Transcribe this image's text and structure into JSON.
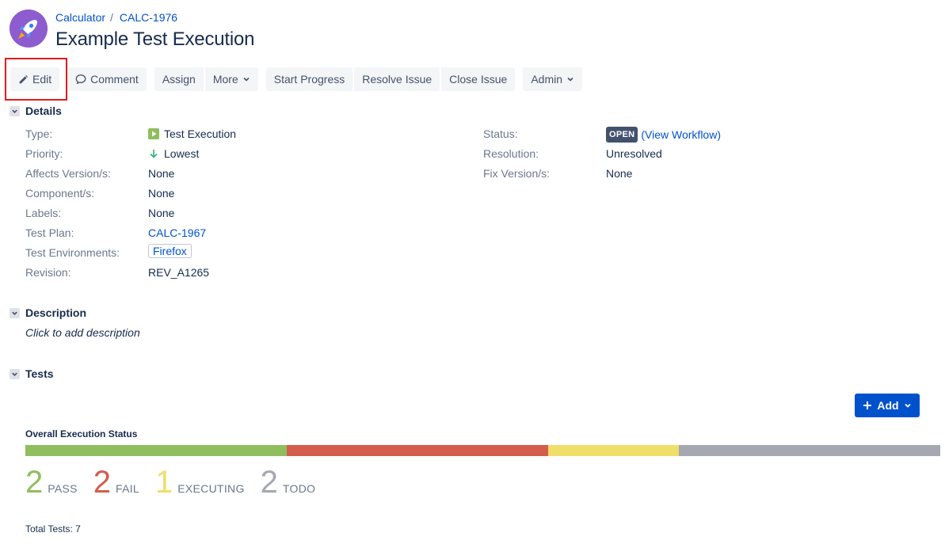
{
  "header": {
    "project": "Calculator",
    "issue_key": "CALC-1976",
    "title": "Example Test Execution"
  },
  "toolbar": {
    "edit": "Edit",
    "comment": "Comment",
    "assign": "Assign",
    "more": "More",
    "start_progress": "Start Progress",
    "resolve_issue": "Resolve Issue",
    "close_issue": "Close Issue",
    "admin": "Admin"
  },
  "details": {
    "heading": "Details",
    "left": [
      {
        "label": "Type:",
        "value": "Test Execution",
        "icon": "test-execution-icon"
      },
      {
        "label": "Priority:",
        "value": "Lowest",
        "icon": "arrow-down-icon"
      },
      {
        "label": "Affects Version/s:",
        "value": "None"
      },
      {
        "label": "Component/s:",
        "value": "None"
      },
      {
        "label": "Labels:",
        "value": "None"
      },
      {
        "label": "Test Plan:",
        "value": "CALC-1967"
      },
      {
        "label": "Test Environments:",
        "value": "Firefox"
      },
      {
        "label": "Revision:",
        "value": "REV_A1265"
      }
    ],
    "right": [
      {
        "label": "Status:",
        "value": "OPEN",
        "extra": "(View Workflow)"
      },
      {
        "label": "Resolution:",
        "value": "Unresolved"
      },
      {
        "label": "Fix Version/s:",
        "value": "None"
      }
    ]
  },
  "description": {
    "heading": "Description",
    "placeholder": "Click to add description"
  },
  "tests": {
    "heading": "Tests",
    "add_label": "Add",
    "overall_label": "Overall Execution Status",
    "status_counts": [
      {
        "label": "PASS",
        "count": "2",
        "color": "#8fbe5e"
      },
      {
        "label": "FAIL",
        "count": "2",
        "color": "#d45d4e"
      },
      {
        "label": "EXECUTING",
        "count": "1",
        "color": "#f0de6b"
      },
      {
        "label": "TODO",
        "count": "2",
        "color": "#a5a8b0"
      }
    ],
    "total_label": "Total Tests: 7"
  },
  "colors": {
    "primary": "#0052cc",
    "highlight": "#e01b1b"
  }
}
